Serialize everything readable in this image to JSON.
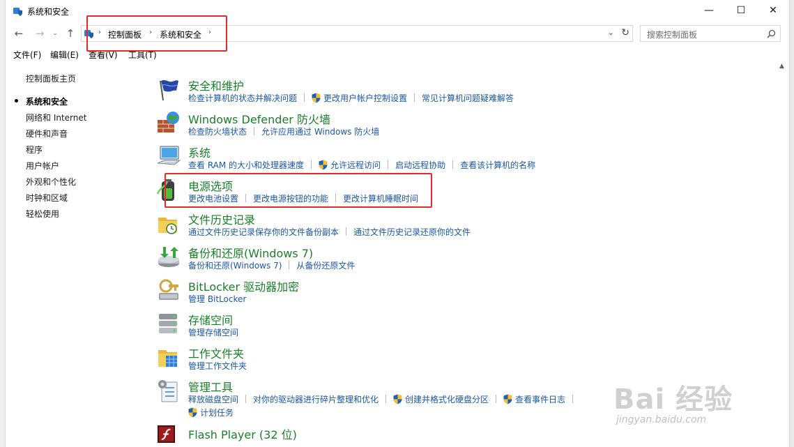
{
  "window": {
    "title": "系统和安全",
    "controls": {
      "minimize": "—",
      "maximize": "☐",
      "close": "✕"
    }
  },
  "nav": {
    "back": "←",
    "forward": "→",
    "recent": "⌄",
    "up": "↑"
  },
  "address": {
    "separator": "›",
    "crumbs": [
      "控制面板",
      "系统和安全"
    ],
    "dropdown": "⌄",
    "refresh": "↻"
  },
  "search": {
    "placeholder": "搜索控制面板"
  },
  "menu": [
    "文件(F)",
    "编辑(E)",
    "查看(V)",
    "工具(T)"
  ],
  "sidebar": {
    "items": [
      {
        "label": "控制面板主页"
      },
      {
        "label": "系统和安全",
        "current": true
      },
      {
        "label": "网络和 Internet"
      },
      {
        "label": "硬件和声音"
      },
      {
        "label": "程序"
      },
      {
        "label": "用户帐户"
      },
      {
        "label": "外观和个性化"
      },
      {
        "label": "时钟和区域"
      },
      {
        "label": "轻松使用"
      }
    ]
  },
  "categories": [
    {
      "title": "安全和维护",
      "icon": "flag-icon",
      "links": [
        {
          "label": "检查计算机的状态并解决问题"
        },
        {
          "label": "更改用户帐户控制设置",
          "shield": true
        },
        {
          "label": "常见计算机问题疑难解答"
        }
      ]
    },
    {
      "title": "Windows Defender 防火墙",
      "icon": "firewall-icon",
      "links": [
        {
          "label": "检查防火墙状态"
        },
        {
          "label": "允许应用通过 Windows 防火墙"
        }
      ]
    },
    {
      "title": "系统",
      "icon": "computer-icon",
      "links": [
        {
          "label": "查看 RAM 的大小和处理器速度"
        },
        {
          "label": "允许远程访问",
          "shield": true
        },
        {
          "label": "启动远程协助"
        },
        {
          "label": "查看该计算机的名称"
        }
      ]
    },
    {
      "title": "电源选项",
      "icon": "power-battery-icon",
      "links": [
        {
          "label": "更改电池设置"
        },
        {
          "label": "更改电源按钮的功能"
        },
        {
          "label": "更改计算机睡眠时间"
        }
      ]
    },
    {
      "title": "文件历史记录",
      "icon": "file-history-icon",
      "links": [
        {
          "label": "通过文件历史记录保存你的文件备份副本"
        },
        {
          "label": "通过文件历史记录还原你的文件"
        }
      ]
    },
    {
      "title": "备份和还原(Windows 7)",
      "icon": "backup-icon",
      "links": [
        {
          "label": "备份和还原(Windows 7)"
        },
        {
          "label": "从备份还原文件"
        }
      ]
    },
    {
      "title": "BitLocker 驱动器加密",
      "icon": "bitlocker-icon",
      "links": [
        {
          "label": "管理 BitLocker"
        }
      ]
    },
    {
      "title": "存储空间",
      "icon": "storage-icon",
      "links": [
        {
          "label": "管理存储空间"
        }
      ]
    },
    {
      "title": "工作文件夹",
      "icon": "work-folders-icon",
      "links": [
        {
          "label": "管理工作文件夹"
        }
      ]
    },
    {
      "title": "管理工具",
      "icon": "admin-tools-icon",
      "links": [
        {
          "label": "释放磁盘空间"
        },
        {
          "label": "对你的驱动器进行碎片整理和优化"
        },
        {
          "label": "创建并格式化硬盘分区",
          "shield": true
        },
        {
          "label": "查看事件日志",
          "shield": true
        }
      ],
      "links2": [
        {
          "label": "计划任务",
          "shield": true
        }
      ]
    },
    {
      "title": "Flash Player (32 位)",
      "icon": "flash-icon",
      "links": []
    }
  ],
  "watermark": {
    "brand": "Bai 经验",
    "url": "jingyan.baidu.com"
  },
  "colors": {
    "category_title": "#1a7f2a",
    "link": "#1c57a5",
    "highlight_box": "#e8262b"
  }
}
